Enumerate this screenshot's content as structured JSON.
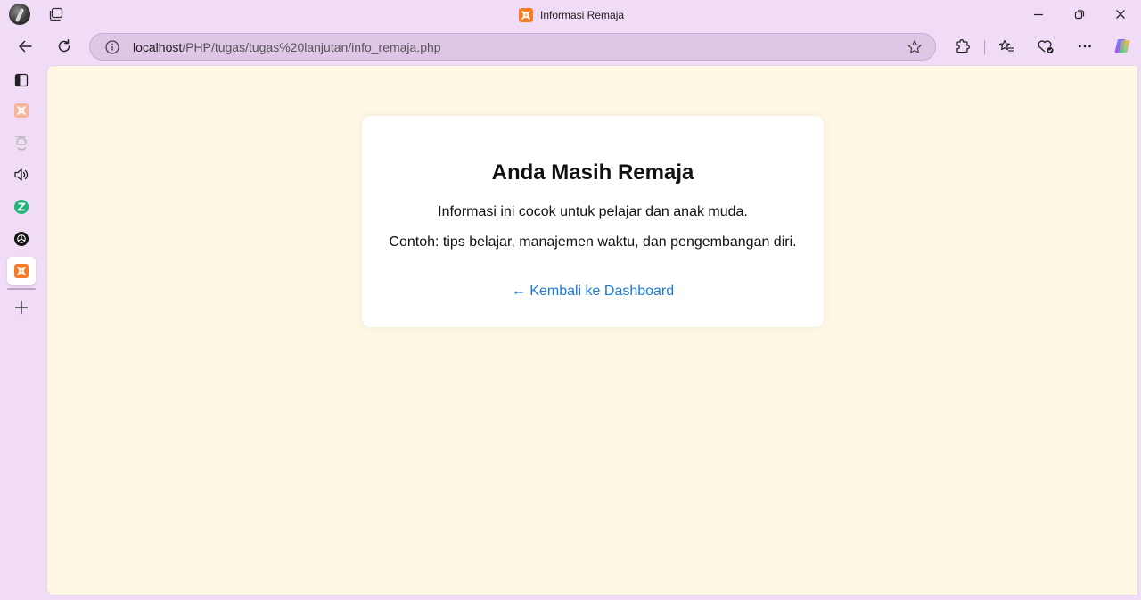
{
  "window": {
    "title": "Informasi Remaja"
  },
  "toolbar": {
    "url_host": "localhost",
    "url_path": "/PHP/tugas/tugas%20lanjutan/info_remaja.php"
  },
  "sidebar": {
    "items": [
      {
        "icon": "sidebar-panel-icon"
      },
      {
        "icon": "xampp-icon"
      },
      {
        "icon": "edge-e-icon"
      },
      {
        "icon": "speaker-icon"
      },
      {
        "icon": "z-app-icon"
      },
      {
        "icon": "openai-icon"
      },
      {
        "icon": "xampp-icon",
        "active": true
      },
      {
        "icon": "plus-icon"
      }
    ]
  },
  "page": {
    "heading": "Anda Masih Remaja",
    "paragraph_1": "Informasi ini cocok untuk pelajar dan anak muda.",
    "paragraph_2": "Contoh: tips belajar, manajemen waktu, dan pengembangan diri.",
    "back_link": "← Kembali ke Dashboard"
  },
  "colors": {
    "page_background": "#fff8e5",
    "link": "#1a7bd6",
    "browser_chrome": "#f1dcf7",
    "xampp_orange": "#fb7a24"
  }
}
